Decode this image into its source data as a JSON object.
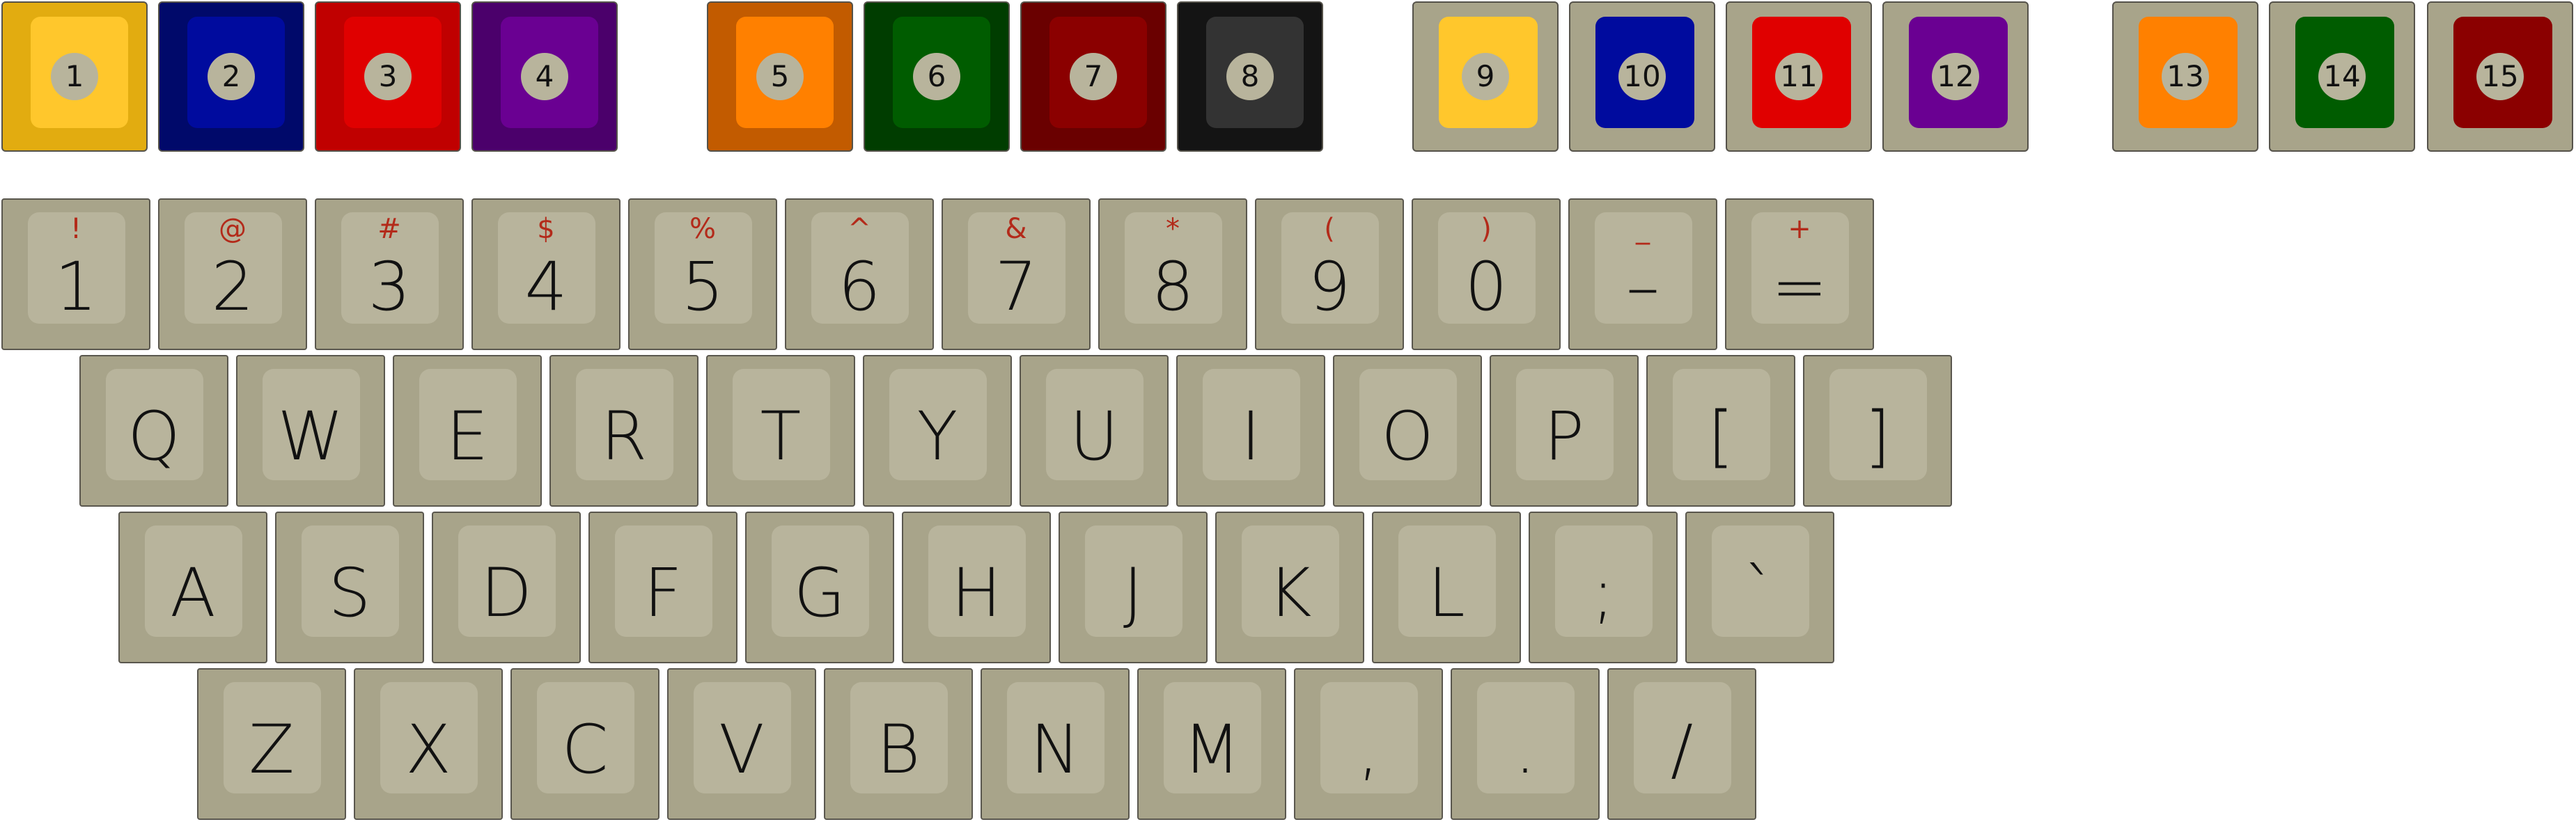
{
  "ball_keys": [
    {
      "label": "1",
      "cap": "#e2ac10",
      "face": "#ffc72c",
      "style": "solid"
    },
    {
      "label": "2",
      "cap": "#00096a",
      "face": "#000b9e",
      "style": "solid"
    },
    {
      "label": "3",
      "cap": "#c00000",
      "face": "#e00000",
      "style": "solid"
    },
    {
      "label": "4",
      "cap": "#4b006b",
      "face": "#6a0092",
      "style": "solid"
    },
    {
      "label": "5",
      "cap": "#c25b00",
      "face": "#ff8000",
      "style": "solid"
    },
    {
      "label": "6",
      "cap": "#003d00",
      "face": "#005c00",
      "style": "solid"
    },
    {
      "label": "7",
      "cap": "#6a0000",
      "face": "#8b0000",
      "style": "solid"
    },
    {
      "label": "8",
      "cap": "#141414",
      "face": "#333333",
      "style": "solid"
    },
    {
      "label": "9",
      "cap": "#a8a48a",
      "face": "#ffc72c",
      "style": "striped"
    },
    {
      "label": "10",
      "cap": "#a8a48a",
      "face": "#000b9e",
      "style": "striped"
    },
    {
      "label": "11",
      "cap": "#a8a48a",
      "face": "#e00000",
      "style": "striped"
    },
    {
      "label": "12",
      "cap": "#a8a48a",
      "face": "#6a0092",
      "style": "striped"
    },
    {
      "label": "13",
      "cap": "#a8a48a",
      "face": "#ff8000",
      "style": "striped"
    },
    {
      "label": "14",
      "cap": "#a8a48a",
      "face": "#005c00",
      "style": "striped"
    },
    {
      "label": "15",
      "cap": "#a8a48a",
      "face": "#8b0000",
      "style": "striped"
    }
  ],
  "number_row": [
    {
      "main": "1",
      "shift": "!"
    },
    {
      "main": "2",
      "shift": "@"
    },
    {
      "main": "3",
      "shift": "#"
    },
    {
      "main": "4",
      "shift": "$"
    },
    {
      "main": "5",
      "shift": "%"
    },
    {
      "main": "6",
      "shift": "^"
    },
    {
      "main": "7",
      "shift": "&"
    },
    {
      "main": "8",
      "shift": "*"
    },
    {
      "main": "9",
      "shift": "("
    },
    {
      "main": "0",
      "shift": ")"
    },
    {
      "main": "–",
      "shift": "_"
    },
    {
      "main": "=",
      "shift": "+"
    }
  ],
  "top_row": [
    "Q",
    "W",
    "E",
    "R",
    "T",
    "Y",
    "U",
    "I",
    "O",
    "P",
    "[",
    "]"
  ],
  "home_row": [
    "A",
    "S",
    "D",
    "F",
    "G",
    "H",
    "J",
    "K",
    "L",
    ";",
    "`"
  ],
  "bottom_row": [
    "Z",
    "X",
    "C",
    "V",
    "B",
    "N",
    "M",
    ",",
    ".",
    "/"
  ],
  "colors": {
    "key_cap": "#a8a48a",
    "key_top": "#b8b49c",
    "legend": "#111111",
    "shift_legend": "#b32a1a"
  }
}
